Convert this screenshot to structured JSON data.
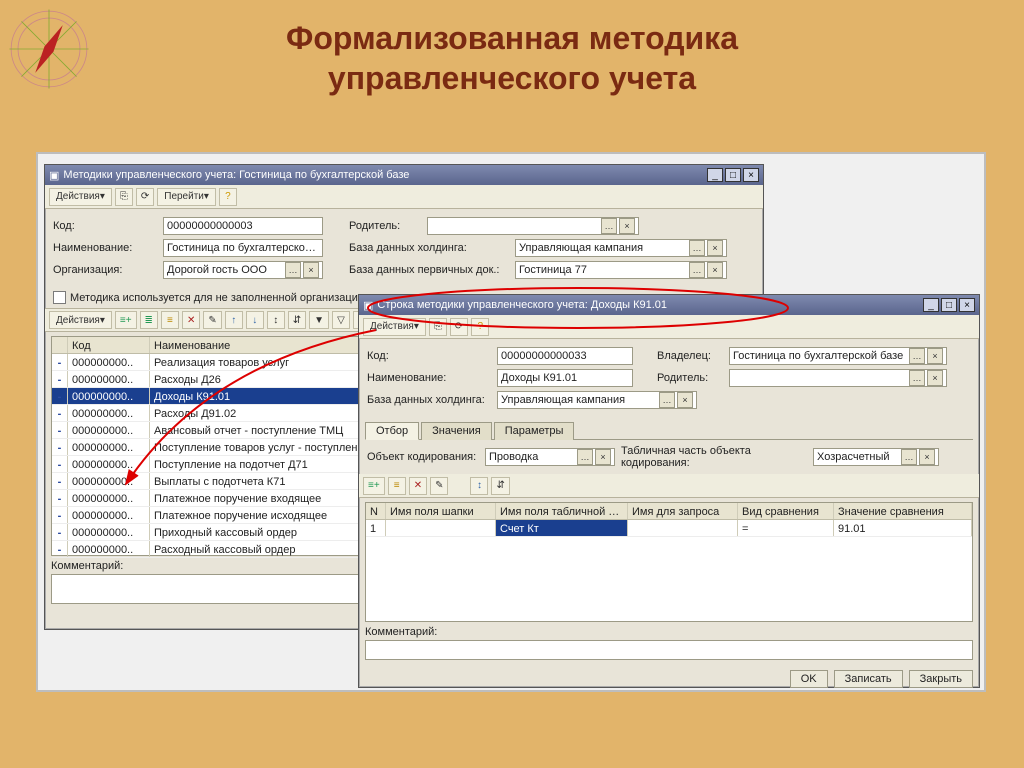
{
  "slide": {
    "title_line1": "Формализованная методика",
    "title_line2": "управленческого учета"
  },
  "win1": {
    "title": "Методики управленческого учета: Гостиница по бухгалтерской базе",
    "actions_label": "Действия",
    "goto_label": "Перейти",
    "labels": {
      "code": "Код:",
      "name": "Наименование:",
      "org": "Организация:",
      "parent": "Родитель:",
      "db_holding": "База данных холдинга:",
      "db_primary": "База данных первичных док.:",
      "checkbox": "Методика используется для не заполненной организации",
      "comment": "Комментарий:"
    },
    "fields": {
      "code": "00000000000003",
      "name": "Гостиница по бухгалтерской базе",
      "org": "Дорогой гость ООО",
      "parent": "",
      "db_holding": "Управляющая кампания",
      "db_primary": "Гостиница 77"
    },
    "table": {
      "headers": {
        "code": "Код",
        "name": "Наименование"
      },
      "rows": [
        {
          "code": "000000000..",
          "name": "Реализация товаров услуг"
        },
        {
          "code": "000000000..",
          "name": "Расходы Д26"
        },
        {
          "code": "000000000..",
          "name": "Доходы К91.01",
          "selected": true
        },
        {
          "code": "000000000..",
          "name": "Расходы Д91.02"
        },
        {
          "code": "000000000..",
          "name": "Авансовый отчет - поступление ТМЦ"
        },
        {
          "code": "000000000..",
          "name": "Поступление товаров услуг - поступление ТМЦ"
        },
        {
          "code": "000000000..",
          "name": "Поступление на подотчет Д71"
        },
        {
          "code": "000000000..",
          "name": "Выплаты с подотчета К71"
        },
        {
          "code": "000000000..",
          "name": "Платежное поручение входящее"
        },
        {
          "code": "000000000..",
          "name": "Платежное поручение исходящее"
        },
        {
          "code": "000000000..",
          "name": "Приходный кассовый ордер"
        },
        {
          "code": "000000000..",
          "name": "Расходный кассовый ордер"
        }
      ]
    }
  },
  "win2": {
    "title": "Строка методики управленческого учета: Доходы К91.01",
    "actions_label": "Действия",
    "labels": {
      "code": "Код:",
      "owner": "Владелец:",
      "name": "Наименование:",
      "parent": "Родитель:",
      "db_holding": "База данных холдинга:",
      "obj": "Объект кодирования:",
      "tab_part": "Табличная часть объекта кодирования:",
      "comment": "Комментарий:"
    },
    "fields": {
      "code": "00000000000033",
      "owner": "Гостиница по бухгалтерской базе",
      "name": "Доходы К91.01",
      "parent": "",
      "db_holding": "Управляющая кампания",
      "obj": "Проводка",
      "tab_part": "Хозрасчетный"
    },
    "tabs": [
      "Отбор",
      "Значения",
      "Параметры"
    ],
    "table": {
      "headers": {
        "n": "N",
        "hat": "Имя поля шапки",
        "tabfield": "Имя поля табличной час..",
        "query": "Имя для запроса",
        "cmp": "Вид сравнения",
        "cmpval": "Значение сравнения"
      },
      "rows": [
        {
          "n": "1",
          "hat": "",
          "tabfield": "Счет Кт",
          "query": "",
          "cmp": "=",
          "cmpval": "91.01"
        }
      ]
    },
    "buttons": {
      "ok": "OK",
      "save": "Записать",
      "close": "Закрыть"
    }
  }
}
